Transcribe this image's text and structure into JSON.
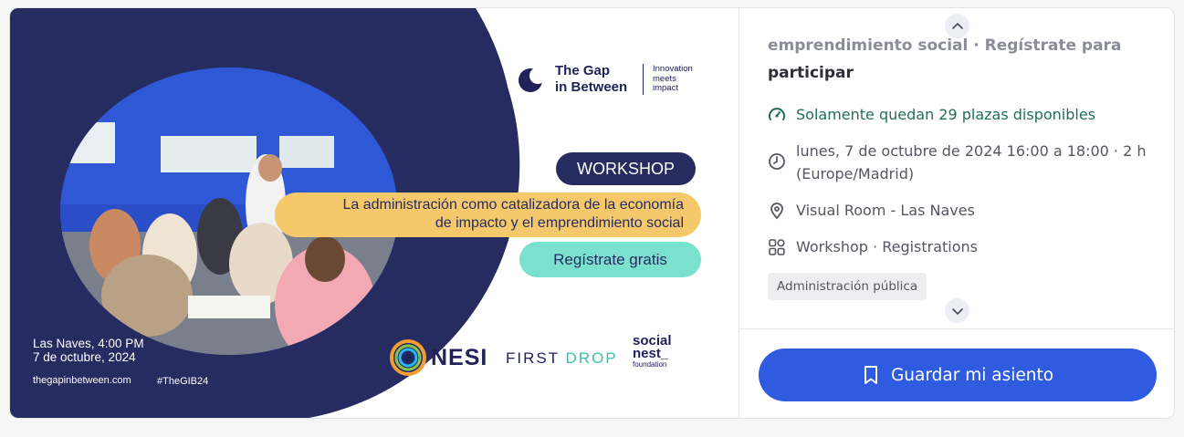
{
  "banner": {
    "brand_name": "The Gap in Between",
    "brand_line1": "The Gap",
    "brand_line2": "in Between",
    "brand_tagline": "Innovation meets impact",
    "tag_line1": "Innovation",
    "tag_line2": "meets",
    "tag_line3": "impact",
    "workshop_label": "WORKSHOP",
    "title_line1": "La administración como catalizadora de la economía",
    "title_line2": "de impacto y el emprendimiento social",
    "register_label": "Regístrate gratis",
    "venue_line1": "Las Naves, 4:00 PM",
    "venue_line2": "7 de octubre, 2024",
    "website": "thegapinbetween.com",
    "hashtag": "#TheGIB24",
    "sponsor1": "NESI",
    "sponsor2_a": "FIRST ",
    "sponsor2_b": "DROP",
    "sponsor3_line1": "social",
    "sponsor3_line2": "nest_",
    "sponsor3_line3": "foundation",
    "colors": {
      "navy": "#262b60",
      "yellow": "#f5c96b",
      "mint": "#7be1cf"
    }
  },
  "info": {
    "heading_faded": "emprendimiento social · Regístrate para",
    "heading_rest": "participar",
    "availability": "Solamente quedan 29 plazas disponibles",
    "datetime": "lunes, 7 de octubre de 2024 16:00 a 18:00 · 2 h (Europe/Madrid)",
    "location": "Visual Room - Las Naves",
    "category": "Workshop · Registrations",
    "tag": "Administración pública",
    "icons": [
      "gauge-icon",
      "clock-icon",
      "location-pin-icon",
      "grid-icon",
      "chevron-up-icon",
      "chevron-down-icon",
      "bookmark-icon"
    ]
  },
  "actions": {
    "save_label": "Guardar mi asiento",
    "accent": "#2e5be0"
  }
}
